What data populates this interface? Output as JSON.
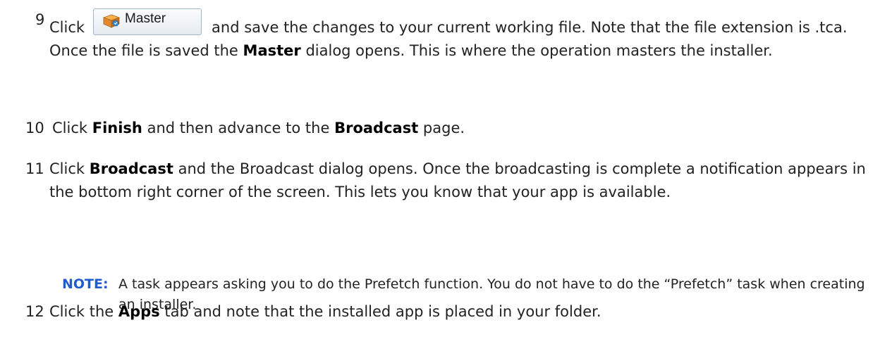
{
  "steps": [
    {
      "number": "9",
      "before": "Click",
      "button_label": "Master",
      "after": "and save the changes to your current working file. Note that the file extension is .tca. Once the file is saved the",
      "bold1": "Master",
      "rest": "dialog opens. This is where the operation masters the installer."
    },
    {
      "number": "10",
      "t1": "Click",
      "b1": "Finish",
      "t2": "and then advance to the",
      "b2": "Broadcast",
      "t3": "page."
    },
    {
      "number": "11",
      "t1": "Click",
      "b1": "Broadcast",
      "t2": "and the Broadcast dialog opens. Once the broadcasting is complete a notification appears in the bottom right corner of the screen. This lets you know that your app is available."
    },
    {
      "number": "12",
      "t1": "Click the",
      "b1": "Apps",
      "t2": "tab and note that the installed app is placed in your folder."
    }
  ],
  "note": {
    "label": "NOTE:",
    "text": "A task appears asking you to do the Prefetch function. You do not have to do the “Prefetch” task when creating an installer."
  },
  "colors": {
    "note_label": "#1f5ccf",
    "text": "#222222"
  },
  "icons": {
    "master_button_icon": "package-box-icon"
  }
}
